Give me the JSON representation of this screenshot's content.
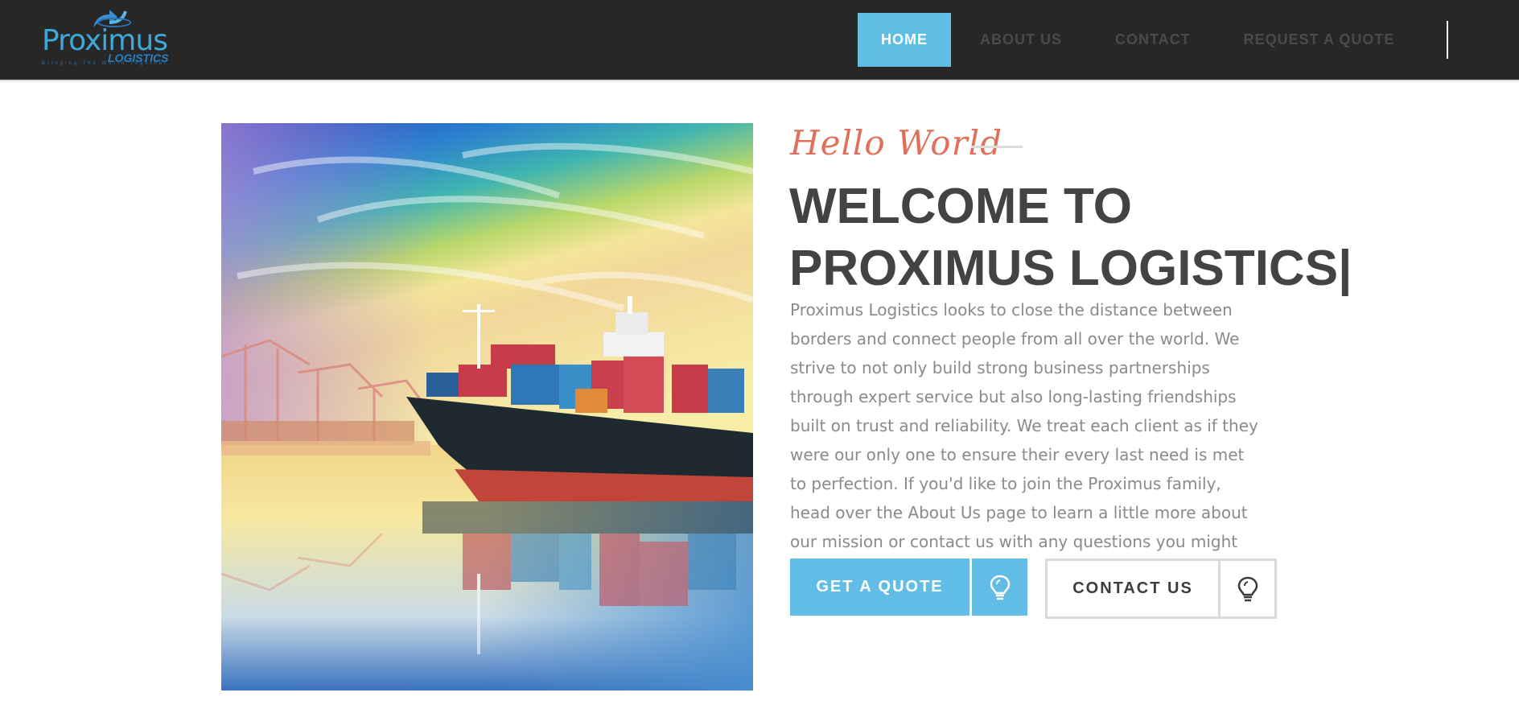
{
  "brand": {
    "logo_text": "Proximus",
    "logo_subtext": "LOGISTICS",
    "logo_tagline": "Bringing The World Together"
  },
  "nav": {
    "items": [
      {
        "label": "HOME",
        "active": true
      },
      {
        "label": "ABOUT US",
        "active": false
      },
      {
        "label": "CONTACT",
        "active": false
      },
      {
        "label": "REQUEST A QUOTE",
        "active": false
      }
    ]
  },
  "hero": {
    "image_icon": "cargo-ship-image",
    "script_title": "Hello World",
    "headline_line1": "WELCOME TO",
    "headline_line2": "PROXIMUS LOGISTICS",
    "cursor": "|",
    "paragraph": "Proximus Logistics looks to close the distance between borders and connect people from all over the world. We strive to not only build strong business partnerships through expert service but also long-lasting friendships built on trust and reliability. We treat each client as if they were our only one to ensure their every last need is met to perfection. If you'd like to join the Proximus family, head over the About Us page to learn a little more about our mission or contact us with any questions you might have."
  },
  "buttons": {
    "quote_label": "GET A QUOTE",
    "quote_icon": "lightbulb-icon",
    "contact_label": "CONTACT US",
    "contact_icon": "lightbulb-icon"
  },
  "colors": {
    "header_bg": "#272727",
    "accent": "#5fbee4",
    "script": "#e0705a",
    "headline": "#434343",
    "body_text": "#8a8a8a"
  }
}
